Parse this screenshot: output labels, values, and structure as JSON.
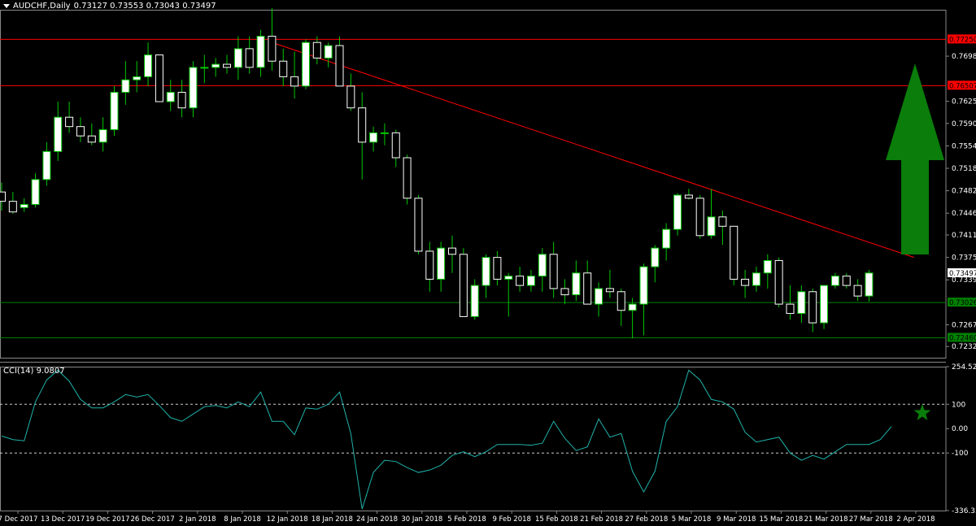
{
  "header": {
    "symbol_tf": "AUDCHF,Daily",
    "ohlc": "0.73127 0.73553 0.73043 0.73497"
  },
  "indicator": {
    "label": "CCI(14) 9.0807"
  },
  "colors": {
    "background": "#000000",
    "bull_candle": "#ffffff",
    "bear_candle": "#000000",
    "wick": "#00c800",
    "red_line": "#ff0000",
    "green_line": "#008000",
    "cci_line": "#20b2aa",
    "arrow": "#0a7d0a",
    "star": "#0a7d0a",
    "red_tag": "#ff0000",
    "green_tag": "#008000",
    "current_tag": "#ffffff"
  },
  "icons": {
    "arrow": "up-arrow-icon",
    "star": "star-icon"
  },
  "chart_data": [
    {
      "type": "candlestick",
      "title": "AUDCHF,Daily",
      "ylim": [
        0.7214,
        0.77725
      ],
      "price_axis_labels": [
        "0.76980",
        "0.76255",
        "0.75900",
        "0.75540",
        "0.75180",
        "0.74820",
        "0.74460",
        "0.74110",
        "0.73750",
        "0.73390",
        "0.72670",
        "0.72320"
      ],
      "highlighted_levels": [
        {
          "value": 0.7725,
          "label": "0.77250",
          "color": "red"
        },
        {
          "value": 0.76507,
          "label": "0.76507",
          "color": "red"
        },
        {
          "value": 0.73026,
          "label": "0.73026",
          "color": "green"
        },
        {
          "value": 0.7246,
          "label": "0.72460",
          "color": "green"
        },
        {
          "value": 0.73497,
          "label": "0.73497",
          "color": "white"
        }
      ],
      "date_labels": [
        "7 Dec 2017",
        "13 Dec 2017",
        "19 Dec 2017",
        "26 Dec 2017",
        "2 Jan 2018",
        "8 Jan 2018",
        "12 Jan 2018",
        "18 Jan 2018",
        "24 Jan 2018",
        "30 Jan 2018",
        "5 Feb 2018",
        "9 Feb 2018",
        "15 Feb 2018",
        "21 Feb 2018",
        "27 Feb 2018",
        "5 Mar 2018",
        "9 Mar 2018",
        "15 Mar 2018",
        "21 Mar 2018",
        "27 Mar 2018",
        "2 Apr 2018"
      ],
      "candles": [
        [
          0.748,
          0.7495,
          0.745,
          0.7465
        ],
        [
          0.7465,
          0.748,
          0.7445,
          0.7448
        ],
        [
          0.7455,
          0.747,
          0.7448,
          0.746
        ],
        [
          0.746,
          0.751,
          0.7455,
          0.75
        ],
        [
          0.75,
          0.756,
          0.749,
          0.7545
        ],
        [
          0.7545,
          0.7625,
          0.753,
          0.76
        ],
        [
          0.76,
          0.7625,
          0.7575,
          0.7585
        ],
        [
          0.7585,
          0.76,
          0.756,
          0.757
        ],
        [
          0.757,
          0.759,
          0.7555,
          0.756
        ],
        [
          0.756,
          0.76,
          0.7545,
          0.758
        ],
        [
          0.758,
          0.765,
          0.757,
          0.764
        ],
        [
          0.764,
          0.769,
          0.762,
          0.766
        ],
        [
          0.766,
          0.769,
          0.764,
          0.7665
        ],
        [
          0.7665,
          0.772,
          0.765,
          0.77
        ],
        [
          0.77,
          0.77,
          0.7625,
          0.7625
        ],
        [
          0.7625,
          0.766,
          0.761,
          0.764
        ],
        [
          0.764,
          0.766,
          0.76,
          0.7615
        ],
        [
          0.7615,
          0.769,
          0.76,
          0.768
        ],
        [
          0.768,
          0.77,
          0.7655,
          0.768
        ],
        [
          0.768,
          0.7695,
          0.7665,
          0.7685
        ],
        [
          0.7685,
          0.77,
          0.767,
          0.768
        ],
        [
          0.768,
          0.773,
          0.766,
          0.771
        ],
        [
          0.771,
          0.773,
          0.767,
          0.768
        ],
        [
          0.768,
          0.774,
          0.7665,
          0.773
        ],
        [
          0.773,
          0.7775,
          0.7675,
          0.769
        ],
        [
          0.769,
          0.771,
          0.765,
          0.7665
        ],
        [
          0.7665,
          0.7705,
          0.763,
          0.765
        ],
        [
          0.765,
          0.7725,
          0.7645,
          0.772
        ],
        [
          0.772,
          0.773,
          0.7685,
          0.7695
        ],
        [
          0.7695,
          0.772,
          0.768,
          0.7715
        ],
        [
          0.7715,
          0.773,
          0.765,
          0.765
        ],
        [
          0.765,
          0.767,
          0.761,
          0.7615
        ],
        [
          0.7615,
          0.764,
          0.75,
          0.756
        ],
        [
          0.756,
          0.7585,
          0.7545,
          0.7575
        ],
        [
          0.7575,
          0.759,
          0.7555,
          0.7575
        ],
        [
          0.7575,
          0.758,
          0.752,
          0.7535
        ],
        [
          0.7535,
          0.754,
          0.746,
          0.747
        ],
        [
          0.747,
          0.7475,
          0.738,
          0.7385
        ],
        [
          0.7385,
          0.74,
          0.732,
          0.734
        ],
        [
          0.734,
          0.74,
          0.732,
          0.739
        ],
        [
          0.739,
          0.741,
          0.735,
          0.738
        ],
        [
          0.738,
          0.739,
          0.728,
          0.728
        ],
        [
          0.728,
          0.734,
          0.7275,
          0.733
        ],
        [
          0.733,
          0.738,
          0.731,
          0.7375
        ],
        [
          0.7375,
          0.7385,
          0.733,
          0.734
        ],
        [
          0.734,
          0.735,
          0.728,
          0.7345
        ],
        [
          0.7345,
          0.736,
          0.732,
          0.733
        ],
        [
          0.733,
          0.7355,
          0.732,
          0.7345
        ],
        [
          0.7345,
          0.739,
          0.732,
          0.738
        ],
        [
          0.738,
          0.74,
          0.731,
          0.7325
        ],
        [
          0.7325,
          0.734,
          0.73,
          0.7315
        ],
        [
          0.7315,
          0.737,
          0.7305,
          0.735
        ],
        [
          0.735,
          0.737,
          0.73,
          0.73
        ],
        [
          0.73,
          0.7335,
          0.728,
          0.7325
        ],
        [
          0.7325,
          0.7355,
          0.731,
          0.732
        ],
        [
          0.732,
          0.7325,
          0.7265,
          0.729
        ],
        [
          0.729,
          0.731,
          0.7245,
          0.73
        ],
        [
          0.73,
          0.7365,
          0.725,
          0.736
        ],
        [
          0.736,
          0.7395,
          0.7335,
          0.739
        ],
        [
          0.739,
          0.743,
          0.737,
          0.742
        ],
        [
          0.742,
          0.7478,
          0.741,
          0.7475
        ],
        [
          0.7475,
          0.7485,
          0.7468,
          0.747
        ],
        [
          0.747,
          0.7475,
          0.7405,
          0.741
        ],
        [
          0.741,
          0.7485,
          0.7405,
          0.744
        ],
        [
          0.744,
          0.745,
          0.7395,
          0.7425
        ],
        [
          0.7425,
          0.7425,
          0.733,
          0.734
        ],
        [
          0.734,
          0.7355,
          0.731,
          0.733
        ],
        [
          0.733,
          0.736,
          0.732,
          0.735
        ],
        [
          0.735,
          0.738,
          0.7325,
          0.737
        ],
        [
          0.737,
          0.7375,
          0.7295,
          0.73
        ],
        [
          0.73,
          0.733,
          0.7275,
          0.7285
        ],
        [
          0.7285,
          0.733,
          0.727,
          0.732
        ],
        [
          0.732,
          0.7325,
          0.7255,
          0.727
        ],
        [
          0.727,
          0.733,
          0.726,
          0.733
        ],
        [
          0.733,
          0.735,
          0.7325,
          0.7345
        ],
        [
          0.7345,
          0.735,
          0.7325,
          0.733
        ],
        [
          0.733,
          0.734,
          0.7305,
          0.7313
        ],
        [
          0.7313,
          0.7355,
          0.7304,
          0.735
        ]
      ],
      "trendline": {
        "x_start_index": 24,
        "y_start": 0.772,
        "x_end_index": 81,
        "y_end": 0.7375
      }
    },
    {
      "type": "line",
      "title": "CCI(14) 9.0807",
      "ylim": [
        -336.3383,
        254.5233
      ],
      "axis_labels": [
        "254.5233",
        "100",
        "0.00",
        "-100",
        "-336.3383"
      ],
      "levels": [
        100,
        -100
      ],
      "values": [
        -30,
        -45,
        -50,
        110,
        200,
        240,
        195,
        120,
        85,
        85,
        110,
        140,
        130,
        140,
        95,
        45,
        30,
        60,
        90,
        95,
        85,
        110,
        90,
        150,
        30,
        30,
        -25,
        85,
        80,
        100,
        150,
        -20,
        -330,
        -180,
        -130,
        -135,
        -160,
        -180,
        -170,
        -150,
        -110,
        -95,
        -115,
        -95,
        -65,
        -65,
        -65,
        -68,
        -60,
        30,
        -40,
        -90,
        -75,
        40,
        -35,
        -20,
        -175,
        -260,
        -175,
        30,
        90,
        240,
        200,
        120,
        110,
        80,
        -15,
        -55,
        -45,
        -35,
        -100,
        -130,
        -110,
        -125,
        -95,
        -65,
        -65,
        -65,
        -45,
        9.08
      ]
    }
  ]
}
